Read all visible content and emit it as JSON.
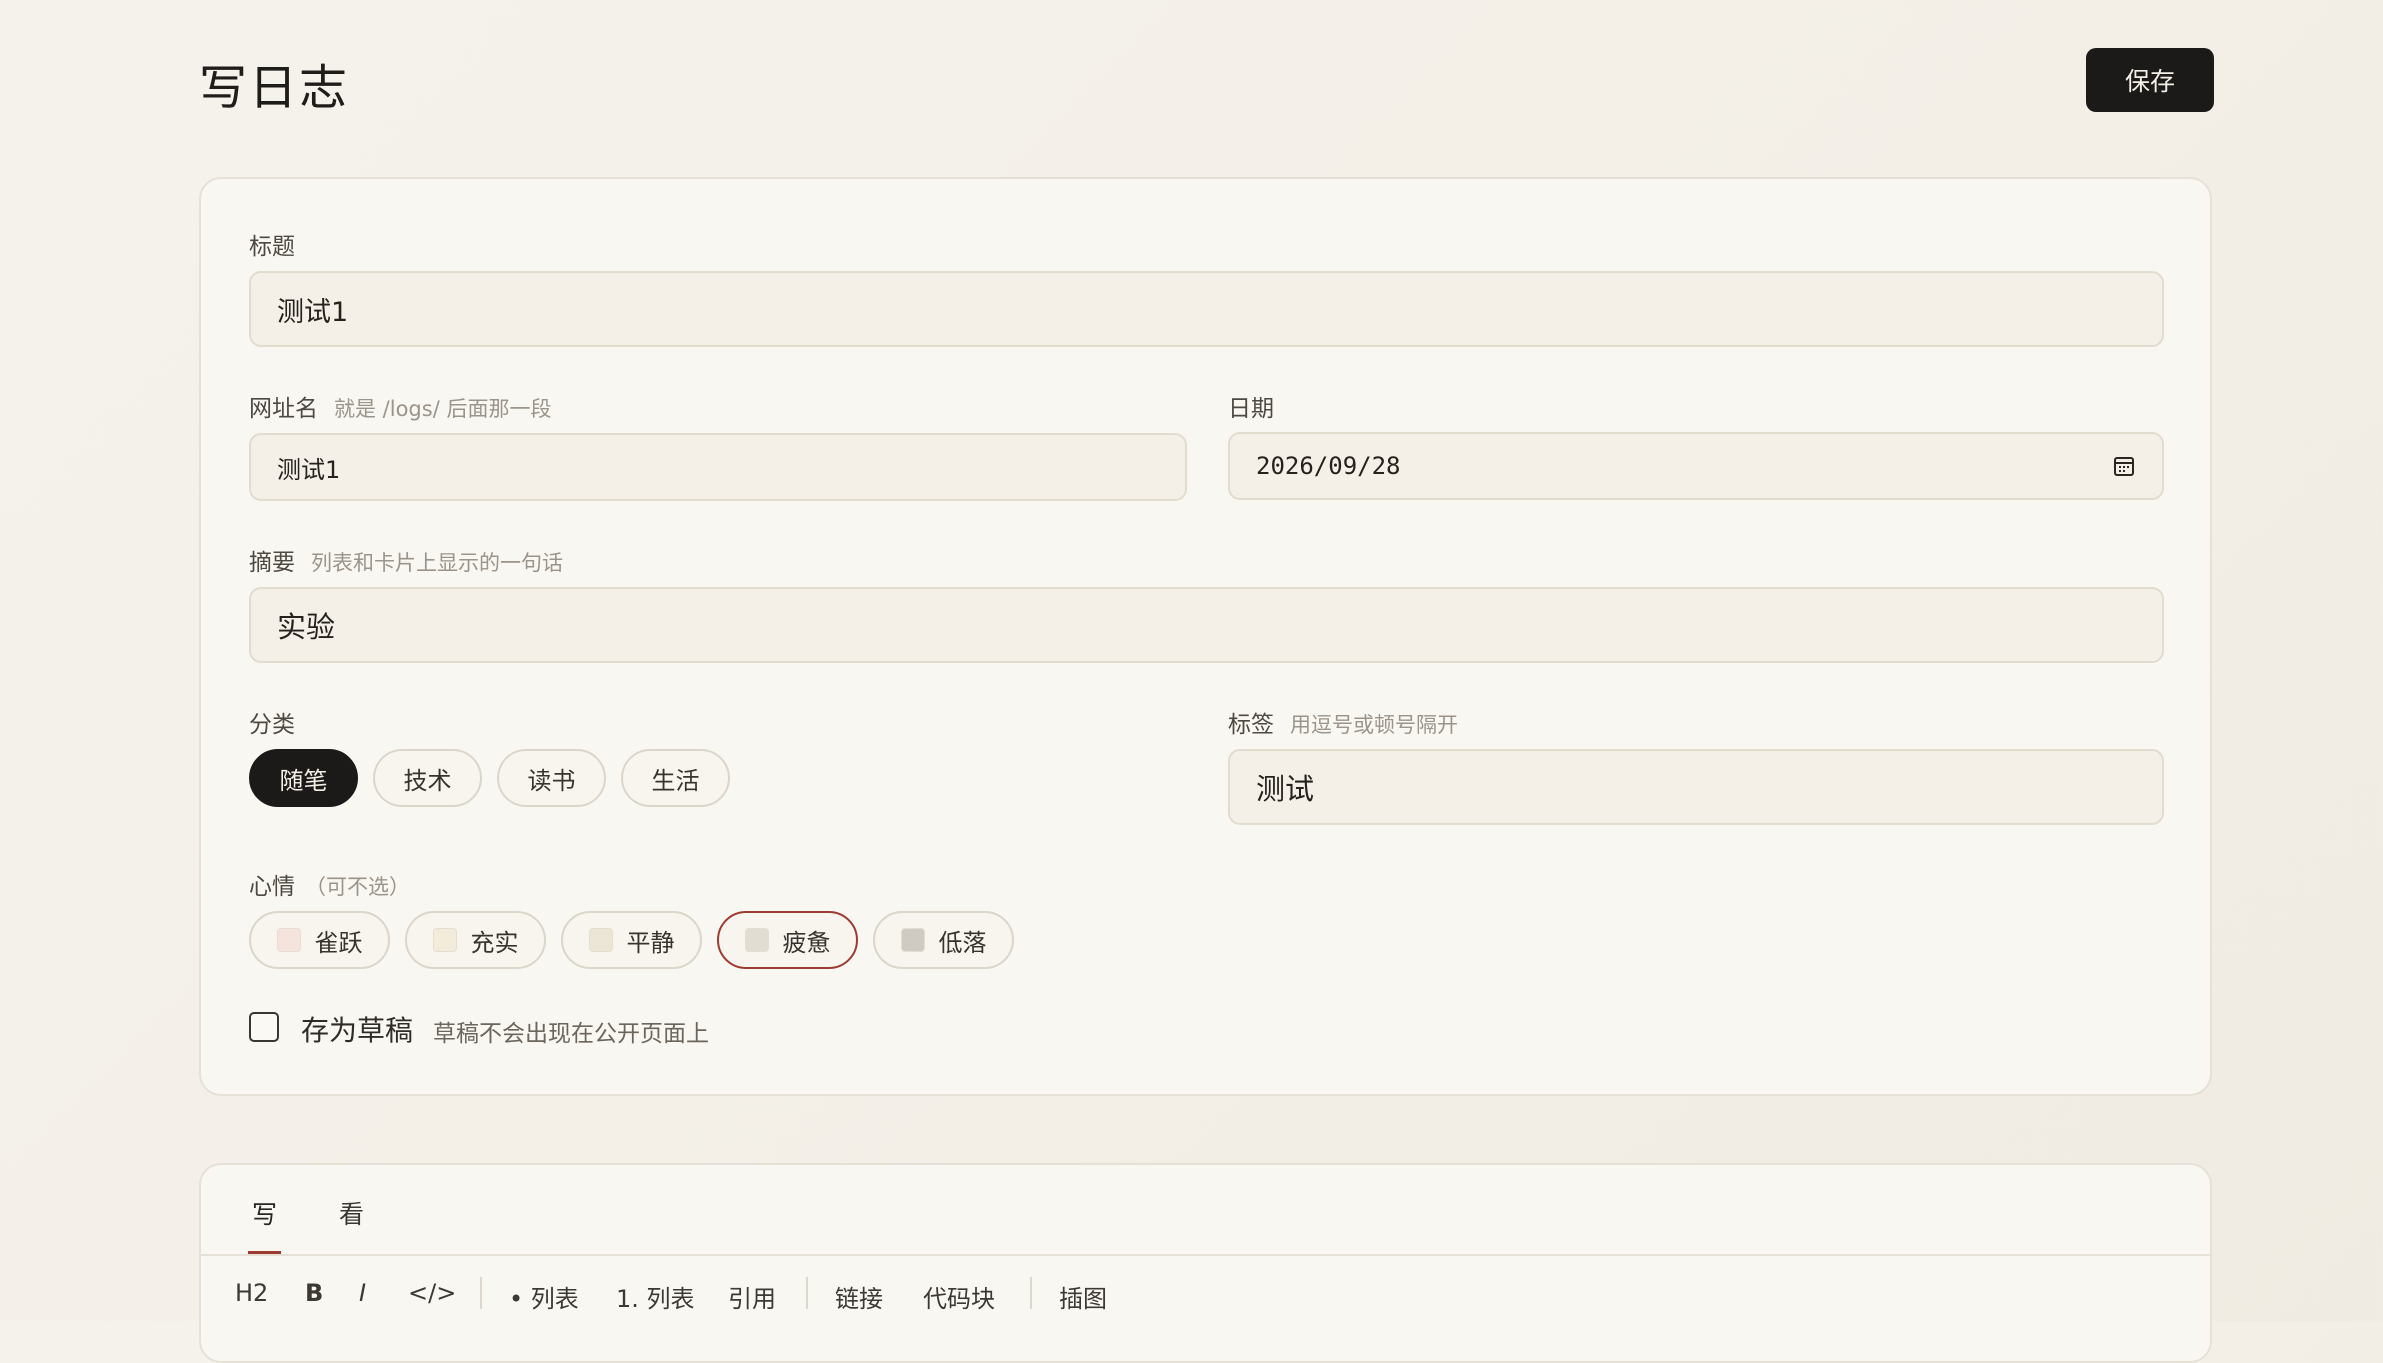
{
  "header": {
    "title": "写日志",
    "save_label": "保存"
  },
  "form": {
    "title": {
      "label": "标题",
      "value": "测试1"
    },
    "slug": {
      "label": "网址名",
      "hint": "就是 /logs/ 后面那一段",
      "value": "测试1"
    },
    "date": {
      "label": "日期",
      "value": "2026/09/28"
    },
    "summary": {
      "label": "摘要",
      "hint": "列表和卡片上显示的一句话",
      "value": "实验"
    },
    "category": {
      "label": "分类",
      "options": [
        "随笔",
        "技术",
        "读书",
        "生活"
      ],
      "selected": "随笔"
    },
    "tags": {
      "label": "标签",
      "hint": "用逗号或顿号隔开",
      "value": "测试"
    },
    "mood": {
      "label": "心情",
      "hint": "（可不选）",
      "options": [
        {
          "label": "雀跃",
          "color": "#f5e3de"
        },
        {
          "label": "充实",
          "color": "#f3ecdb"
        },
        {
          "label": "平静",
          "color": "#ece6d6"
        },
        {
          "label": "疲惫",
          "color": "#e2ddd2"
        },
        {
          "label": "低落",
          "color": "#cfcbc2"
        }
      ],
      "selected": "疲惫"
    },
    "draft": {
      "label": "存为草稿",
      "hint": "草稿不会出现在公开页面上",
      "checked": false
    }
  },
  "editor": {
    "tabs": [
      "写",
      "看"
    ],
    "active_tab": "写",
    "toolbar": [
      "H2",
      "B",
      "I",
      "</>",
      "• 列表",
      "1. 列表",
      "引用",
      "链接",
      "代码块",
      "插图"
    ]
  }
}
